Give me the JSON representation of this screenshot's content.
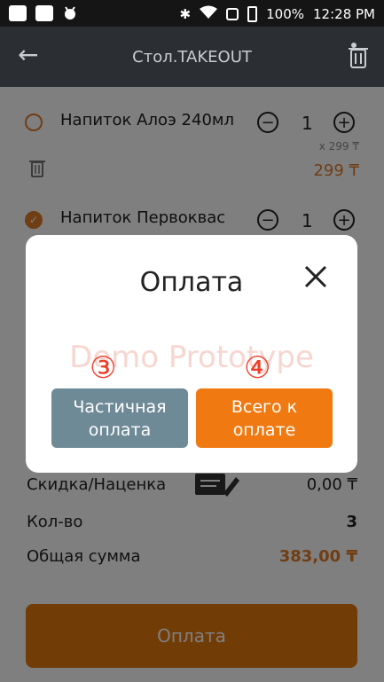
{
  "status_bar": {
    "battery": "100%",
    "time": "12:28 PM"
  },
  "toolbar": {
    "title": "Стол.TAKEOUT"
  },
  "items": [
    {
      "name": "Напиток Алоэ 240мл",
      "quantity": "1",
      "per_price": "x 299 ₸",
      "total": "299 ₸",
      "selected": false
    },
    {
      "name": "Напиток Первоквас",
      "quantity": "1",
      "selected": true
    }
  ],
  "summary": {
    "discount_label": "Скидка/Наценка",
    "discount_value": "0,00 ₸",
    "qty_label": "Кол-во",
    "qty_value": "3",
    "total_label": "Общая сумма",
    "total_value": "383,00 ₸"
  },
  "pay_button_label": "Оплата",
  "dialog": {
    "title": "Оплата",
    "watermark": "Demo Prototype",
    "badge_partial": "③",
    "badge_total": "④",
    "partial_line1": "Частичная",
    "partial_line2": "оплата",
    "total_line1": "Всего к",
    "total_line2": "оплате"
  },
  "colors": {
    "accent": "#e5790e",
    "toolbar": "#2b2f33",
    "partial_button": "#6e8a96"
  }
}
